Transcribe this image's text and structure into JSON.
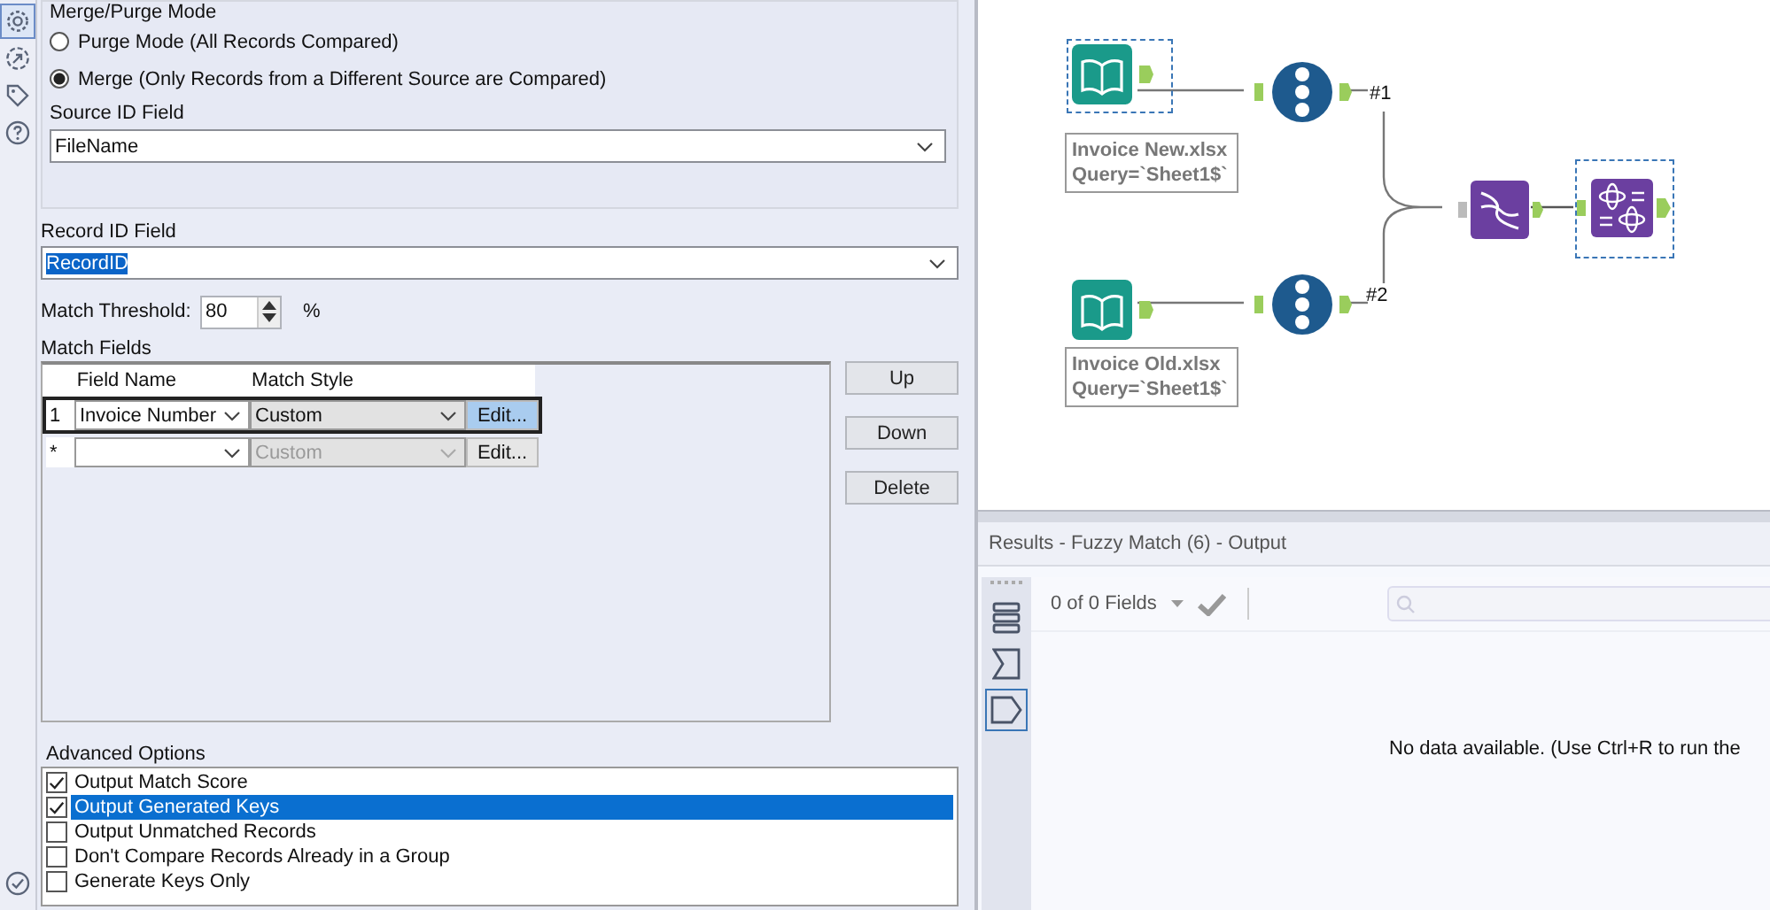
{
  "tool_tabs": [
    {
      "selected": true
    },
    {
      "selected": false
    },
    {
      "selected": false
    },
    {
      "selected": false
    }
  ],
  "config": {
    "merge_purge_mode": {
      "title": "Merge/Purge Mode",
      "options": [
        {
          "label": "Purge Mode (All Records Compared)",
          "selected": false
        },
        {
          "label": "Merge (Only Records from a Different Source are Compared)",
          "selected": true
        }
      ],
      "source_id_field": {
        "label": "Source ID Field",
        "value": "FileName"
      }
    },
    "record_id_field": {
      "label": "Record ID Field",
      "value": "RecordID",
      "selected": true
    },
    "match_threshold": {
      "label": "Match Threshold:",
      "value": "80",
      "unit": "%"
    },
    "match_fields": {
      "title": "Match Fields",
      "columns": [
        "Field Name",
        "Match Style"
      ],
      "rows": [
        {
          "marker": "1",
          "field_name": "Invoice Number",
          "match_style": "Custom",
          "button": "Edit...",
          "selected": true,
          "disabled": false
        },
        {
          "marker": "*",
          "match_style": "Custom",
          "button": "Edit...",
          "selected": false,
          "disabled": true
        }
      ],
      "buttons": [
        "Up",
        "Down",
        "Delete"
      ]
    },
    "advanced_options": {
      "title": "Advanced Options",
      "items": [
        {
          "label": "Output Match Score",
          "checked": true,
          "selected": false
        },
        {
          "label": "Output Generated Keys",
          "checked": true,
          "selected": true
        },
        {
          "label": "Output Unmatched Records",
          "checked": false,
          "selected": false
        },
        {
          "label": "Don't Compare Records Already in a Group",
          "checked": false,
          "selected": false
        },
        {
          "label": "Generate Keys Only",
          "checked": false,
          "selected": false
        }
      ]
    }
  },
  "canvas": {
    "nodes": [
      {
        "kind": "input",
        "selected": true,
        "label_lines": [
          "Invoice New.xlsx",
          "Query=`Sheet1$`"
        ]
      },
      {
        "kind": "record_id",
        "selected": false
      },
      {
        "kind": "input",
        "selected": false,
        "label_lines": [
          "Invoice Old.xlsx",
          "Query=`Sheet1$`"
        ]
      },
      {
        "kind": "record_id",
        "selected": false
      },
      {
        "kind": "fuzzy_match",
        "selected": false
      },
      {
        "kind": "unique",
        "selected": true
      }
    ],
    "anchors": [
      "#1",
      "#2"
    ]
  },
  "results": {
    "title": "Results - Fuzzy Match (6) - Output",
    "view_tabs": [
      {
        "selected": false
      },
      {
        "selected": false
      },
      {
        "selected": true
      }
    ],
    "fields_count": "0 of 0 Fields",
    "empty_message": "No data available. (Use Ctrl+R to run the"
  }
}
